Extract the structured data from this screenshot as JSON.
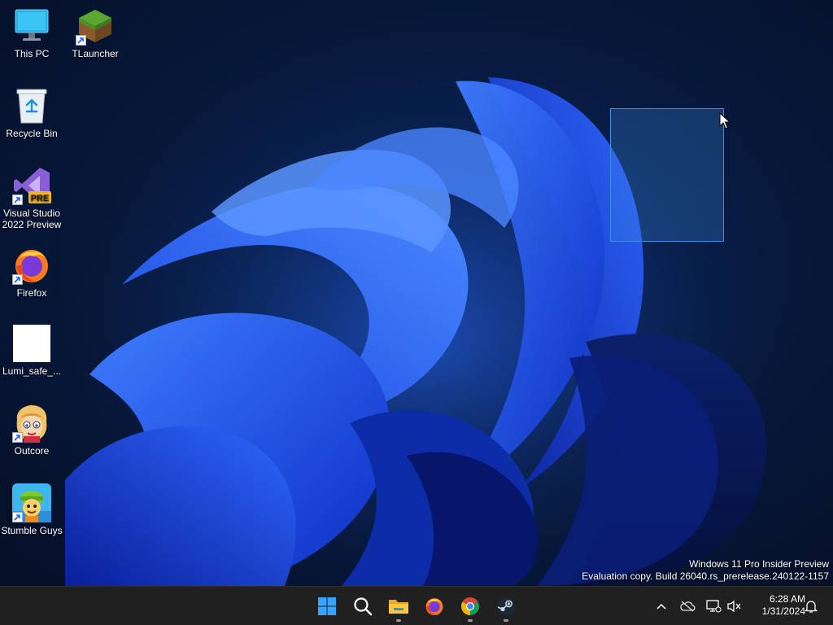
{
  "desktop": {
    "icons": [
      {
        "label": "This PC",
        "icon": "monitor-icon"
      },
      {
        "label": "TLauncher",
        "icon": "grass-block-icon"
      },
      {
        "label": "Recycle Bin",
        "icon": "recycle-bin-icon"
      },
      {
        "label": "Visual Studio 2022 Preview",
        "icon": "visual-studio-icon",
        "badge": "PRE"
      },
      {
        "label": "Firefox",
        "icon": "firefox-icon"
      },
      {
        "label": "Lumi_safe_...",
        "icon": "blank-file-icon"
      },
      {
        "label": "Outcore",
        "icon": "outcore-character-icon"
      },
      {
        "label": "Stumble Guys",
        "icon": "stumble-guys-icon"
      }
    ],
    "watermark": {
      "line1": "Windows 11 Pro Insider Preview",
      "line2": "Evaluation copy. Build 26040.rs_prerelease.240122-1157"
    }
  },
  "taskbar": {
    "apps": [
      {
        "name": "Start",
        "icon": "windows-start-icon",
        "running": false
      },
      {
        "name": "Search",
        "icon": "search-icon",
        "running": false
      },
      {
        "name": "File Explorer",
        "icon": "folder-icon",
        "running": true
      },
      {
        "name": "Firefox",
        "icon": "firefox-icon",
        "running": false
      },
      {
        "name": "Google Chrome",
        "icon": "chrome-icon",
        "running": true
      },
      {
        "name": "Steam",
        "icon": "steam-icon",
        "running": true
      }
    ],
    "tray": {
      "icons": [
        "chevron-up-icon",
        "onedrive-offline-icon",
        "network-icon",
        "volume-muted-icon",
        "notification-bell-icon"
      ],
      "time": "6:28 AM",
      "date": "1/31/2024"
    }
  },
  "colors": {
    "accent": "#1f5cff",
    "taskbar": "#202020",
    "selection": "#3a8ee6"
  }
}
